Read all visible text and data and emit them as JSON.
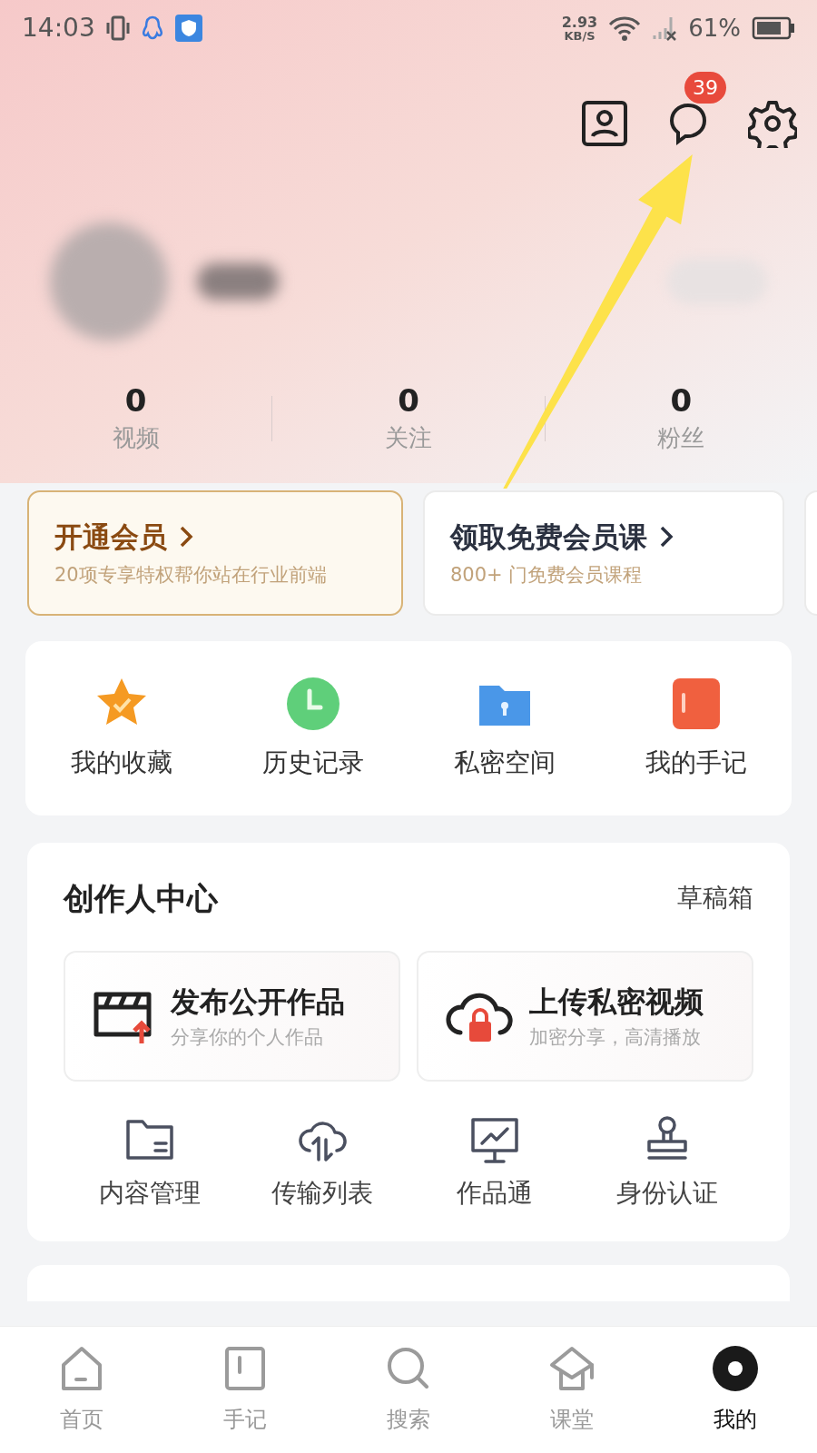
{
  "status_bar": {
    "time": "14:03",
    "speed_value": "2.93",
    "speed_unit": "KB/S",
    "battery": "61%"
  },
  "header": {
    "message_badge": "39"
  },
  "stats": [
    {
      "value": "0",
      "label": "视频"
    },
    {
      "value": "0",
      "label": "关注"
    },
    {
      "value": "0",
      "label": "粉丝"
    }
  ],
  "promo_cards": [
    {
      "kind": "vip",
      "title": "开通会员",
      "subtitle": "20项专享特权帮你站在行业前端"
    },
    {
      "kind": "course",
      "title": "领取免费会员课",
      "subtitle": "800+ 门免费会员课程"
    }
  ],
  "quick_links": [
    {
      "kind": "star",
      "label": "我的收藏"
    },
    {
      "kind": "clock",
      "label": "历史记录"
    },
    {
      "kind": "folder",
      "label": "私密空间"
    },
    {
      "kind": "notebook",
      "label": "我的手记"
    }
  ],
  "creator_center": {
    "title": "创作人中心",
    "drafts": "草稿箱",
    "actions": [
      {
        "kind": "publish",
        "title": "发布公开作品",
        "subtitle": "分享你的个人作品"
      },
      {
        "kind": "upload",
        "title": "上传私密视频",
        "subtitle": "加密分享，高清播放"
      }
    ],
    "tools": [
      {
        "kind": "folder",
        "label": "内容管理"
      },
      {
        "kind": "cloud",
        "label": "传输列表"
      },
      {
        "kind": "board",
        "label": "作品通"
      },
      {
        "kind": "stamp",
        "label": "身份认证"
      }
    ]
  },
  "bottom_nav": [
    {
      "kind": "home",
      "label": "首页",
      "selected": false
    },
    {
      "kind": "notes",
      "label": "手记",
      "selected": false
    },
    {
      "kind": "search",
      "label": "搜索",
      "selected": false
    },
    {
      "kind": "class",
      "label": "课堂",
      "selected": false
    },
    {
      "kind": "me",
      "label": "我的",
      "selected": true
    }
  ]
}
